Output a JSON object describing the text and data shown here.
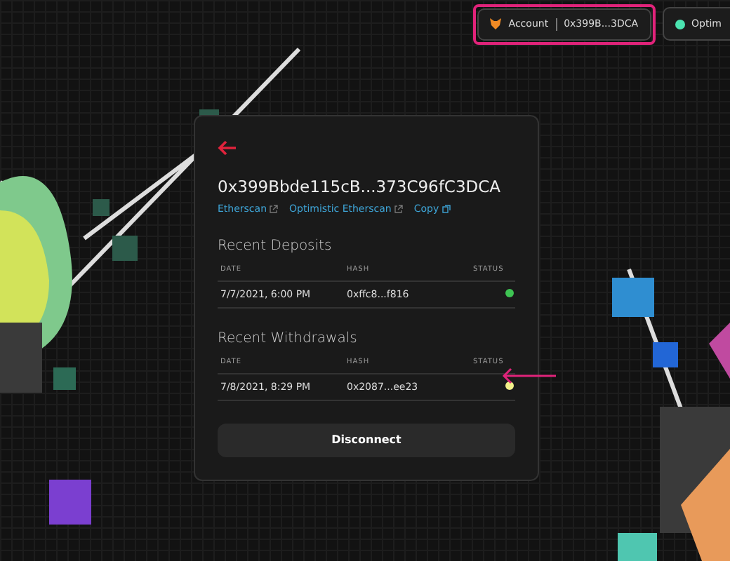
{
  "header": {
    "account_label": "Account",
    "account_address": "0x399B...3DCA",
    "network": "Optim"
  },
  "modal": {
    "address": "0x399Bbde115cB...373C96fC3DCA",
    "links": [
      {
        "label": "Etherscan",
        "kind": "external"
      },
      {
        "label": "Optimistic Etherscan",
        "kind": "external"
      },
      {
        "label": "Copy",
        "kind": "copy"
      }
    ],
    "sections": [
      {
        "title": "Recent Deposits",
        "columns": [
          "DATE",
          "HASH",
          "STATUS"
        ],
        "rows": [
          {
            "date": "7/7/2021, 6:00 PM",
            "hash": "0xffc8...f816",
            "color": "#3ec453"
          }
        ]
      },
      {
        "title": "Recent Withdrawals",
        "columns": [
          "DATE",
          "HASH",
          "STATUS"
        ],
        "rows": [
          {
            "date": "7/8/2021, 8:29 PM",
            "hash": "0x2087...ee23",
            "color": "#f3f08a"
          }
        ]
      }
    ],
    "button": "Disconnect"
  }
}
